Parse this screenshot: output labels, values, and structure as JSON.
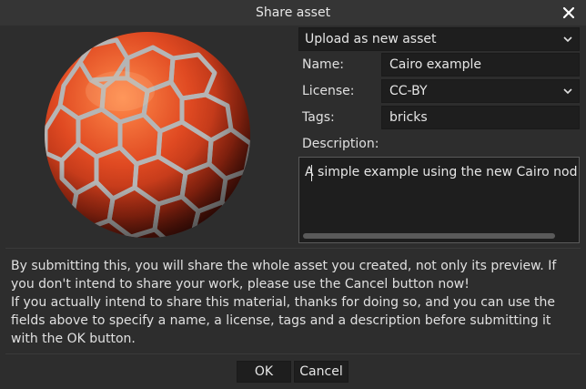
{
  "window": {
    "title": "Share asset",
    "close_symbol": "✕"
  },
  "mode_select": {
    "value": "Upload as new asset"
  },
  "form": {
    "name_label": "Name:",
    "name_value": "Cairo example",
    "license_label": "License:",
    "license_value": "CC-BY",
    "tags_label": "Tags:",
    "tags_value": "bricks",
    "description_label": "Description:",
    "description_value": "A simple example using the new Cairo nod"
  },
  "info": {
    "paragraph1": "By submitting this, you will share the whole asset you created, not only its preview. If you don't intend to share your work, please use the Cancel button now!",
    "paragraph2": "If you actually intend to share this material, thanks for doing so, and you can use the fields above to specify a name, a license, tags and a description before submitting it with the OK button."
  },
  "buttons": {
    "ok": "OK",
    "cancel": "Cancel"
  },
  "preview": {
    "description": "red hexagonal brick material sphere"
  },
  "colors": {
    "background": "#2d2d2d",
    "field": "#1e1e1e",
    "text": "#e0e0e0",
    "brick": "#e0502a",
    "grout": "#a8a8a8"
  }
}
